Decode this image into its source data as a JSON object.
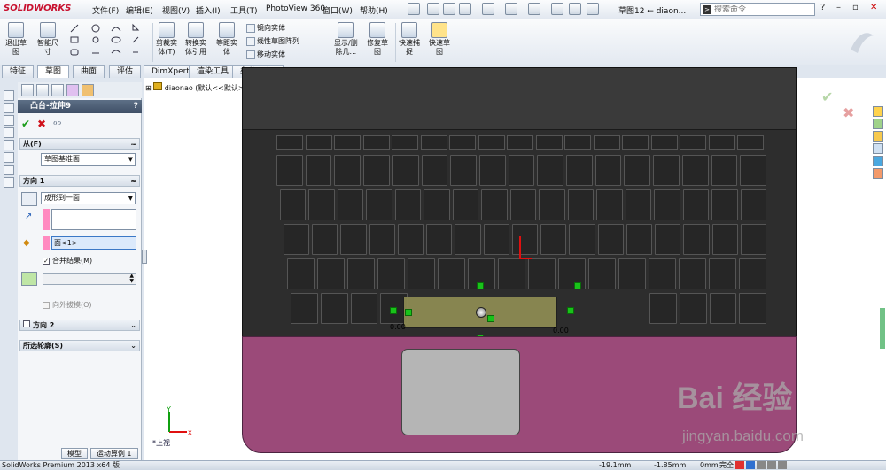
{
  "app": {
    "logo": "SOLIDWORKS",
    "doc_title": "草图12 ← diaon...",
    "search_placeholder": "搜索命令"
  },
  "menu": [
    "文件(F)",
    "编辑(E)",
    "视图(V)",
    "插入(I)",
    "工具(T)",
    "PhotoView 360",
    "窗口(W)",
    "帮助(H)"
  ],
  "ribbon": {
    "exit_sketch": "退出草\n图",
    "smart_dim": "智能尺\n寸",
    "trim": "剪裁实\n体(T)",
    "convert": "转换实\n体引用",
    "offset": "等距实\n体",
    "mirror": "镜向实体",
    "linear_pattern": "线性草图阵列",
    "move": "移动实体",
    "display_delete": "显示/删\n除几...",
    "repair": "修复草\n图",
    "quick_snap": "快速捕\n捉",
    "rapid_sketch": "快速草\n图"
  },
  "tabs": [
    "特征",
    "草图",
    "曲面",
    "评估",
    "DimXpert",
    "渲染工具",
    "办公室产品"
  ],
  "active_tab": "草图",
  "feature_manager": {
    "root": "diaonao  (默认<<默认>_..."
  },
  "property_manager": {
    "title": "凸台-拉伸9",
    "from_group": "从(F)",
    "from_value": "草图基准面",
    "dir1_group": "方向 1",
    "dir1_value": "成形到一面",
    "face_value": "面<1>",
    "merge_result": "合并结果(M)",
    "draft_outward": "向外拔模(O)",
    "dir2_group": "方向 2",
    "contours_group": "所选轮廓(S)"
  },
  "viewport": {
    "view_label": "*上视",
    "dim_left": "0.00",
    "dim_right": "0.00"
  },
  "bottom_tabs": [
    "模型",
    "运动算例 1"
  ],
  "status": {
    "product": "SolidWorks Premium 2013 x64 版",
    "x": "-19.1mm",
    "y": "-1.85mm",
    "z": "0mm",
    "state": "完全"
  },
  "watermark": {
    "brand": "Bai 经验",
    "url": "jingyan.baidu.com"
  },
  "colors": {
    "palm": "#9b4a79",
    "sketch": "#8c8a52",
    "accent_green": "#19c21a"
  }
}
